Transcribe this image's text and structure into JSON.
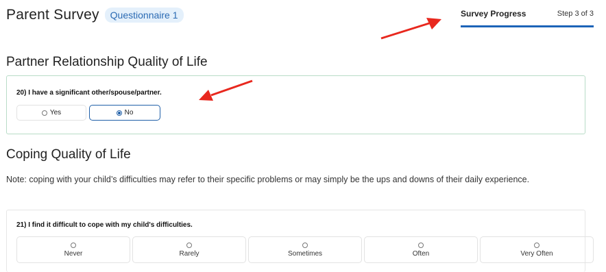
{
  "header": {
    "title": "Parent Survey",
    "badge": "Questionnaire 1"
  },
  "progress": {
    "label": "Survey Progress",
    "step": "Step 3 of 3",
    "percent": 100,
    "bar_color": "#1c63b8"
  },
  "sections": {
    "partner": {
      "title": "Partner Relationship Quality of Life",
      "question": "20) I have a significant other/spouse/partner.",
      "options": [
        {
          "label": "Yes",
          "selected": false
        },
        {
          "label": "No",
          "selected": true
        }
      ]
    },
    "coping": {
      "title": "Coping Quality of Life",
      "note": "Note: coping with your child’s difficulties may refer to their specific problems or may simply be the ups and downs of their daily experience.",
      "question": "21) I find it difficult to cope with my child's difficulties.",
      "options": [
        "Never",
        "Rarely",
        "Sometimes",
        "Often",
        "Very Often"
      ]
    }
  },
  "annotations": {
    "arrow_color": "#e8281e"
  },
  "colors": {
    "accent": "#1f5fa8",
    "card_border_active": "#b8dcc7",
    "badge_bg": "#e4f0fb"
  }
}
